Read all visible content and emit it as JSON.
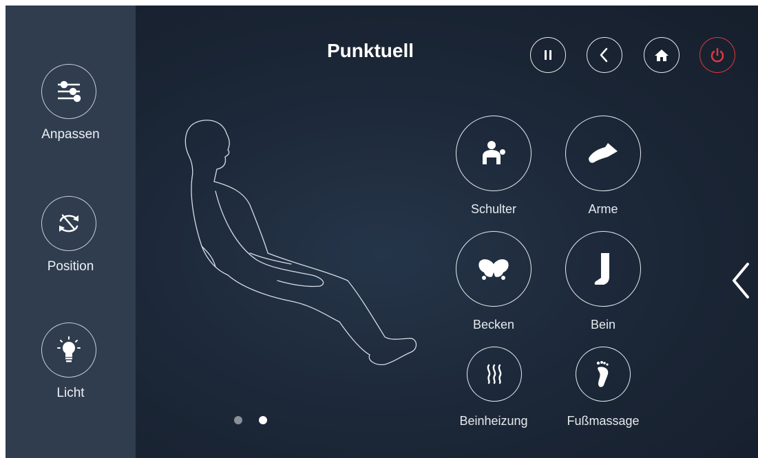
{
  "colors": {
    "sidebar": "#2f3d4f",
    "background": "#1b2636",
    "power_accent": "#e0383f",
    "dot_inactive": "#8a9099",
    "dot_active": "#ffffff"
  },
  "header": {
    "title": "Punktuell",
    "buttons": [
      {
        "icon": "pause-icon"
      },
      {
        "icon": "back-icon"
      },
      {
        "icon": "home-icon"
      },
      {
        "icon": "power-icon"
      }
    ]
  },
  "sidebar": {
    "items": [
      {
        "label": "Anpassen",
        "icon": "sliders-icon"
      },
      {
        "label": "Position",
        "icon": "rotate-icon"
      },
      {
        "label": "Licht",
        "icon": "lightbulb-icon"
      }
    ]
  },
  "functions": [
    {
      "label": "Schulter",
      "icon": "shoulder-icon"
    },
    {
      "label": "Arme",
      "icon": "arm-icon"
    },
    {
      "label": "Becken",
      "icon": "pelvis-icon"
    },
    {
      "label": "Bein",
      "icon": "leg-icon"
    },
    {
      "label": "Beinheizung",
      "icon": "heating-icon"
    },
    {
      "label": "Fußmassage",
      "icon": "foot-icon"
    }
  ],
  "pagination": {
    "pages": 2,
    "current": 2
  },
  "nav": {
    "next_icon": "chevron-left-icon"
  }
}
